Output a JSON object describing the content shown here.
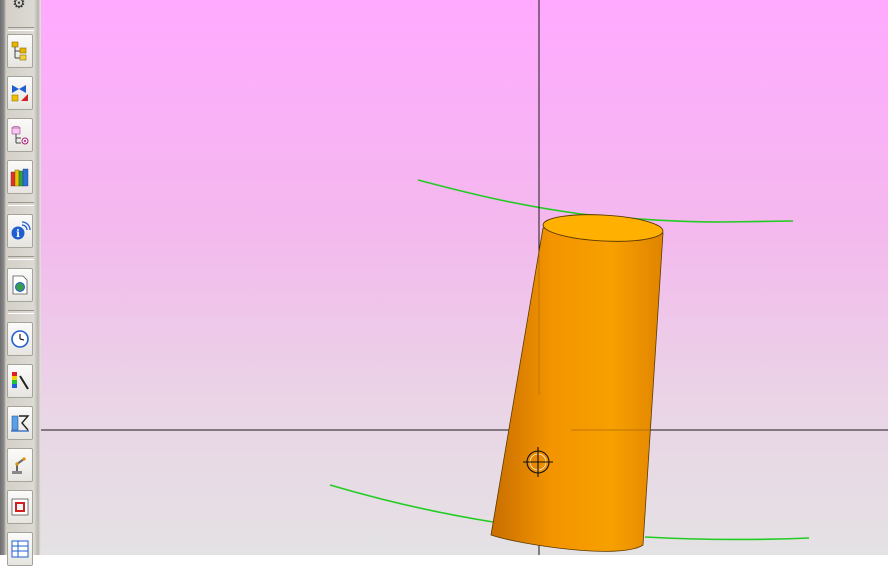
{
  "toolbar": {
    "settings_icon": "gear-icon",
    "buttons": [
      {
        "name": "hierarchy-tree-icon"
      },
      {
        "name": "constraint-bowtie-icon"
      },
      {
        "name": "database-tree-icon"
      },
      {
        "name": "library-books-icon"
      },
      {
        "name": "info-signal-icon"
      },
      {
        "name": "document-globe-icon"
      },
      {
        "name": "clock-icon"
      },
      {
        "name": "color-scale-icon"
      },
      {
        "name": "analysis-tool-icon"
      },
      {
        "name": "robot-arm-icon"
      },
      {
        "name": "report-window-icon"
      },
      {
        "name": "grid-panel-icon"
      }
    ]
  },
  "viewport": {
    "background_top": "#ffaaff",
    "background_bottom": "#e4e2e4",
    "object": "cylinder",
    "object_color": "#f59a00",
    "guide_curve_color": "#22cc22",
    "axis_color": "#1a1a1a",
    "cursor_icon": "crosshair-target-icon"
  }
}
